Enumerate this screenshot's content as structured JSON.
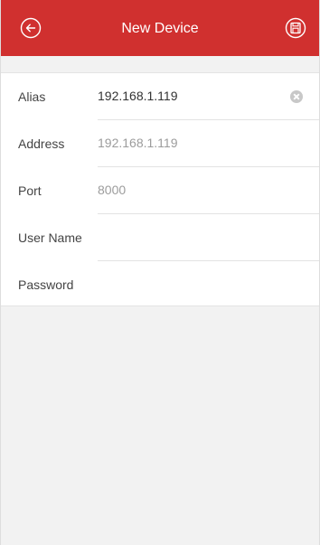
{
  "header": {
    "title": "New Device",
    "back_icon": "back-arrow-circle-icon",
    "save_icon": "save-floppy-circle-icon",
    "background_color": "#d0302f"
  },
  "form": {
    "alias": {
      "label": "Alias",
      "value": "192.168.1.119",
      "placeholder": "",
      "clear_icon": "clear-x-icon"
    },
    "address": {
      "label": "Address",
      "value": "",
      "placeholder": "192.168.1.119"
    },
    "port": {
      "label": "Port",
      "value": "",
      "placeholder": "8000"
    },
    "username": {
      "label": "User Name",
      "value": "",
      "placeholder": ""
    },
    "password": {
      "label": "Password",
      "value": "",
      "placeholder": ""
    }
  }
}
